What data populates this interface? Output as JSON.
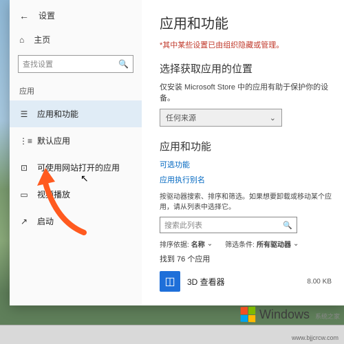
{
  "window": {
    "back_title": "设置",
    "home": "主页",
    "search_placeholder": "查找设置",
    "section": "应用",
    "nav": [
      {
        "icon": "☰",
        "label": "应用和功能"
      },
      {
        "icon": "⋮≡",
        "label": "默认应用"
      },
      {
        "icon": "⊡",
        "label": "可使用网站打开的应用"
      },
      {
        "icon": "▭",
        "label": "视频播放"
      },
      {
        "icon": "↗",
        "label": "启动"
      }
    ]
  },
  "content": {
    "title": "应用和功能",
    "warning": "*其中某些设置已由组织隐藏或管理。",
    "source_heading": "选择获取应用的位置",
    "source_desc": "仅安装 Microsoft Store 中的应用有助于保护你的设备。",
    "source_value": "任何来源",
    "features_heading": "应用和功能",
    "optional_link": "可选功能",
    "alias_link": "应用执行别名",
    "filter_desc": "按驱动器搜索、排序和筛选。如果想要卸载或移动某个应用，请从列表中选择它。",
    "search_apps_placeholder": "搜索此列表",
    "sort_label": "排序依据:",
    "sort_value": "名称",
    "filter_label": "筛选条件:",
    "filter_value": "所有驱动器",
    "found": "找到 76 个应用",
    "app": {
      "name": "3D 查看器",
      "size": "8.00 KB"
    }
  },
  "watermark": {
    "brand": "Windows",
    "sub": "系统之家",
    "url": "www.bjjcrcw.com"
  }
}
